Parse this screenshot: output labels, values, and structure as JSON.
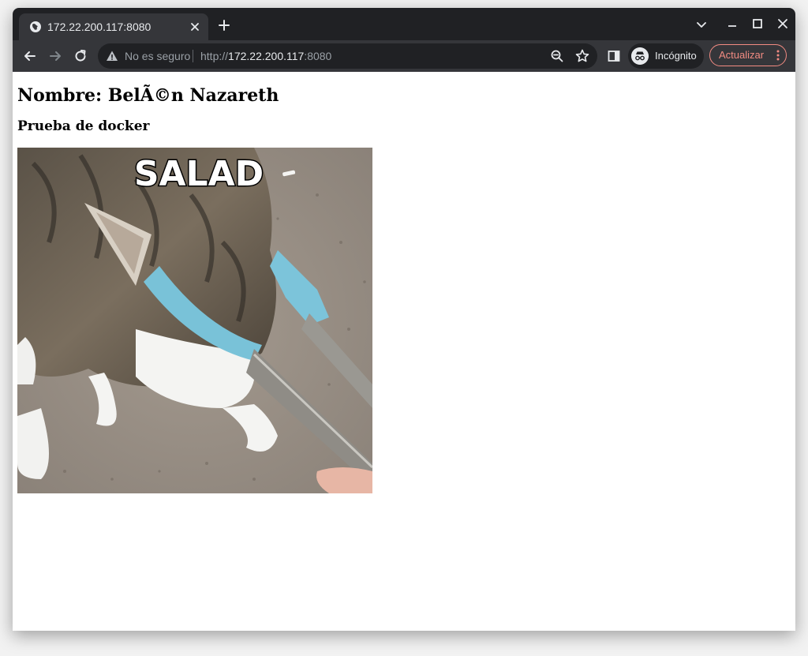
{
  "browser": {
    "tab": {
      "title": "172.22.200.117:8080",
      "icon": "globe-icon"
    },
    "new_tab_icon": "plus-icon",
    "window_controls": [
      "tab-search-icon",
      "minimize-icon",
      "maximize-icon",
      "close-icon"
    ],
    "toolbar": {
      "back_icon": "arrow-left-icon",
      "forward_icon": "arrow-right-icon",
      "reload_icon": "reload-icon",
      "security_label": "No es seguro",
      "url_scheme": "http://",
      "url_host": "172.22.200.117",
      "url_port": ":8080",
      "zoom_icon": "zoom-out-icon",
      "bookmark_icon": "star-icon",
      "side_panel_icon": "side-panel-icon",
      "profile_label": "Incógnito",
      "update_label": "Actualizar"
    },
    "colors": {
      "frame": "#202124",
      "toolbar": "#35363a",
      "update_accent": "#f28b82"
    }
  },
  "page": {
    "heading": "Nombre: BelÃ©n Nazareth",
    "subheading": "Prueba de docker",
    "image": {
      "caption": "SALAD",
      "subject": "cat-with-tongs"
    }
  }
}
